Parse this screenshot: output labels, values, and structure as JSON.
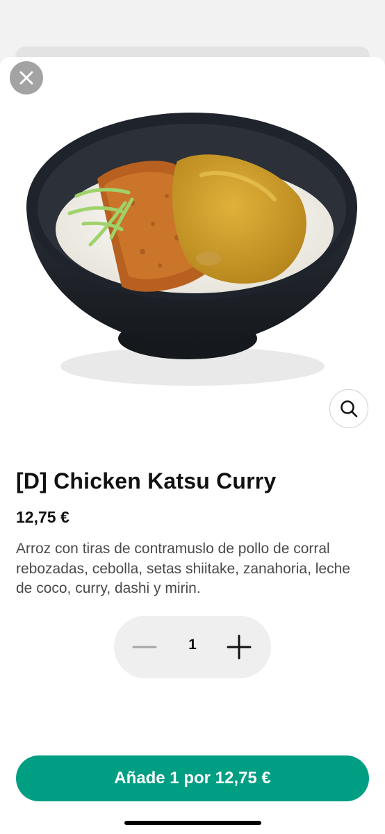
{
  "product": {
    "title": "[D] Chicken Katsu Curry",
    "price": "12,75 €",
    "description": "Arroz con tiras de contramuslo de pollo de corral rebozadas, cebolla, setas shiitake, zanahoria, leche de coco, curry, dashi y mirin."
  },
  "quantity": {
    "value": "1"
  },
  "cta": {
    "label": "Añade 1 por 12,75 €"
  },
  "icons": {
    "close": "close-icon",
    "zoom": "magnifier-icon",
    "minus": "minus-icon",
    "plus": "plus-icon"
  },
  "colors": {
    "accent": "#009e82",
    "close_button": "#a3a3a3",
    "stepper_bg": "#efefef"
  }
}
